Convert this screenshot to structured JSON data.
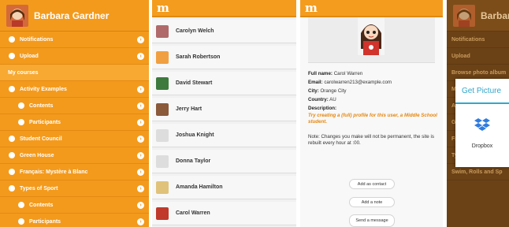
{
  "drawer": {
    "user_name": "Barbara Gardner",
    "items": [
      {
        "label": "Notifications",
        "icon": "comment-icon",
        "section": false
      },
      {
        "label": "Upload",
        "icon": "cloud-upload-icon",
        "section": false
      },
      {
        "label": "My courses",
        "icon": "",
        "section": true
      },
      {
        "label": "Activity Examples",
        "icon": "course-badge-icon",
        "section": false
      },
      {
        "label": "Contents",
        "icon": "cloud-icon",
        "section": false
      },
      {
        "label": "Participants",
        "icon": "people-icon",
        "section": false
      },
      {
        "label": "Student Council",
        "icon": "course-badge-icon",
        "section": false
      },
      {
        "label": "Green House",
        "icon": "course-badge-icon",
        "section": false
      },
      {
        "label": "Français: Mystère à Blanc",
        "icon": "course-badge-icon",
        "section": false
      },
      {
        "label": "Types of Sport",
        "icon": "course-badge-icon",
        "section": false
      },
      {
        "label": "Contents",
        "icon": "cloud-icon",
        "section": false
      },
      {
        "label": "Participants",
        "icon": "people-icon",
        "section": false
      }
    ]
  },
  "participants": {
    "logo": "m",
    "people": [
      {
        "name": "Carolyn Welch",
        "color": "#b06a6a"
      },
      {
        "name": "Sarah Robertson",
        "color": "#f0a040"
      },
      {
        "name": "David Stewart",
        "color": "#3e7a3e"
      },
      {
        "name": "Jerry Hart",
        "color": "#8a5a3a"
      },
      {
        "name": "Joshua Knight",
        "color": "#dddddd"
      },
      {
        "name": "Donna Taylor",
        "color": "#dddddd"
      },
      {
        "name": "Amanda Hamilton",
        "color": "#e0c27a"
      },
      {
        "name": "Carol Warren",
        "color": "#c0392b"
      }
    ]
  },
  "profile": {
    "logo": "m",
    "full_name_label": "Full name:",
    "full_name": "Carol Warren",
    "email_label": "Email:",
    "email": "carolwarren213@example.com",
    "city_label": "City:",
    "city": "Orange City",
    "country_label": "Country:",
    "country": "AU",
    "description_label": "Description:",
    "description": "Try creating a (full) profile for this user, a Middle School student.",
    "note": "Note: Changes you make will not be permanent, the site is rebuilt every hour at :00.",
    "buttons": {
      "add_contact": "Add as contact",
      "add_note": "Add a note",
      "send_message": "Send a message"
    }
  },
  "dialog_panel": {
    "user_name": "Barbara Gardner",
    "rows": [
      "Notifications",
      "Upload",
      "Browse photo album",
      "My courses",
      "Activity Examples",
      "Green House",
      "Français: Mystère à",
      "Types of Sport",
      "Swim, Rolls and Sp"
    ],
    "dialog_title": "Get Picture",
    "dropbox_label": "Dropbox"
  }
}
